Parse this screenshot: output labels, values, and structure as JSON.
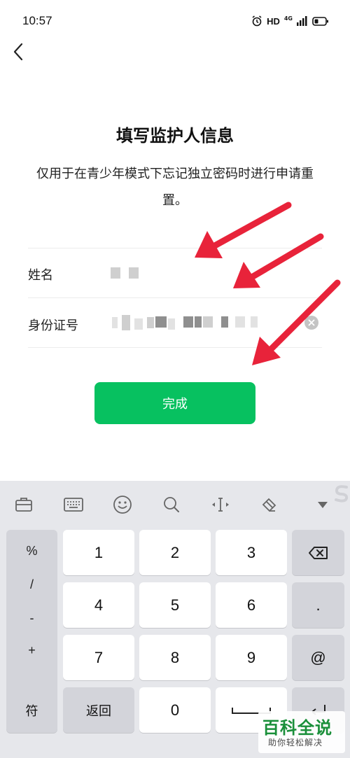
{
  "status_bar": {
    "time": "10:57",
    "hd": "HD",
    "network": "4G"
  },
  "header": {
    "back_icon": "chevron-left-icon"
  },
  "page": {
    "title": "填写监护人信息",
    "subtitle": "仅用于在青少年模式下忘记独立密码时进行申请重置。"
  },
  "form": {
    "name_label": "姓名",
    "id_label": "身份证号",
    "submit_label": "完成"
  },
  "keyboard": {
    "toolbar_icons": [
      "briefcase-icon",
      "keyboard-icon",
      "emoji-icon",
      "search-icon",
      "cursor-icon",
      "paint-icon",
      "collapse-icon"
    ],
    "side_keys": [
      "%",
      "/",
      "-",
      "+"
    ],
    "digits": [
      "1",
      "2",
      "3",
      "4",
      "5",
      "6",
      "7",
      "8",
      "9"
    ],
    "zero": "0",
    "dot": ".",
    "at": "@",
    "symbol": "符",
    "back": "返回"
  },
  "watermark": {
    "main": "百科全说",
    "sub": "助你轻松解决"
  },
  "colors": {
    "accent": "#07c160",
    "annotation_arrow": "#e8233a",
    "keyboard_bg": "#e6e7eb"
  }
}
